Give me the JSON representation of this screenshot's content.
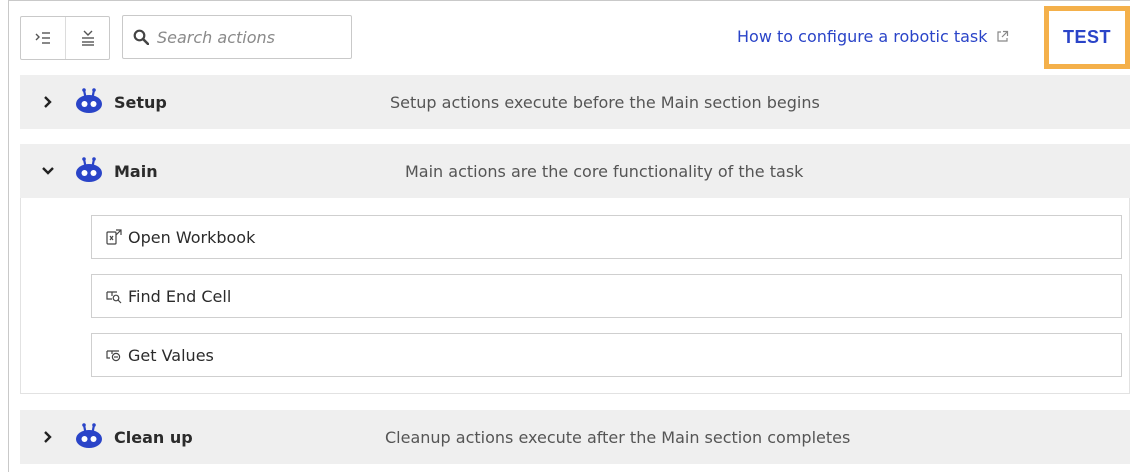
{
  "toolbar": {
    "expand_all_icon": "expand-all-icon",
    "collapse_all_icon": "collapse-all-icon",
    "search_placeholder": "Search actions",
    "help_link_label": "How to configure a robotic task",
    "test_button_label": "TEST"
  },
  "sections": [
    {
      "title": "Setup",
      "description": "Setup actions execute before the Main section begins",
      "expanded": false
    },
    {
      "title": "Main",
      "description": "Main actions are the core functionality of the task",
      "expanded": true,
      "actions": [
        {
          "label": "Open Workbook",
          "icon": "open-workbook-icon"
        },
        {
          "label": "Find End Cell",
          "icon": "find-cell-icon"
        },
        {
          "label": "Get Values",
          "icon": "get-values-icon"
        }
      ]
    },
    {
      "title": "Clean up",
      "description": "Cleanup actions execute after the Main section completes",
      "expanded": false
    }
  ],
  "colors": {
    "accent": "#2a44c8",
    "highlight": "#f4b04a",
    "header_bg": "#efefef"
  }
}
